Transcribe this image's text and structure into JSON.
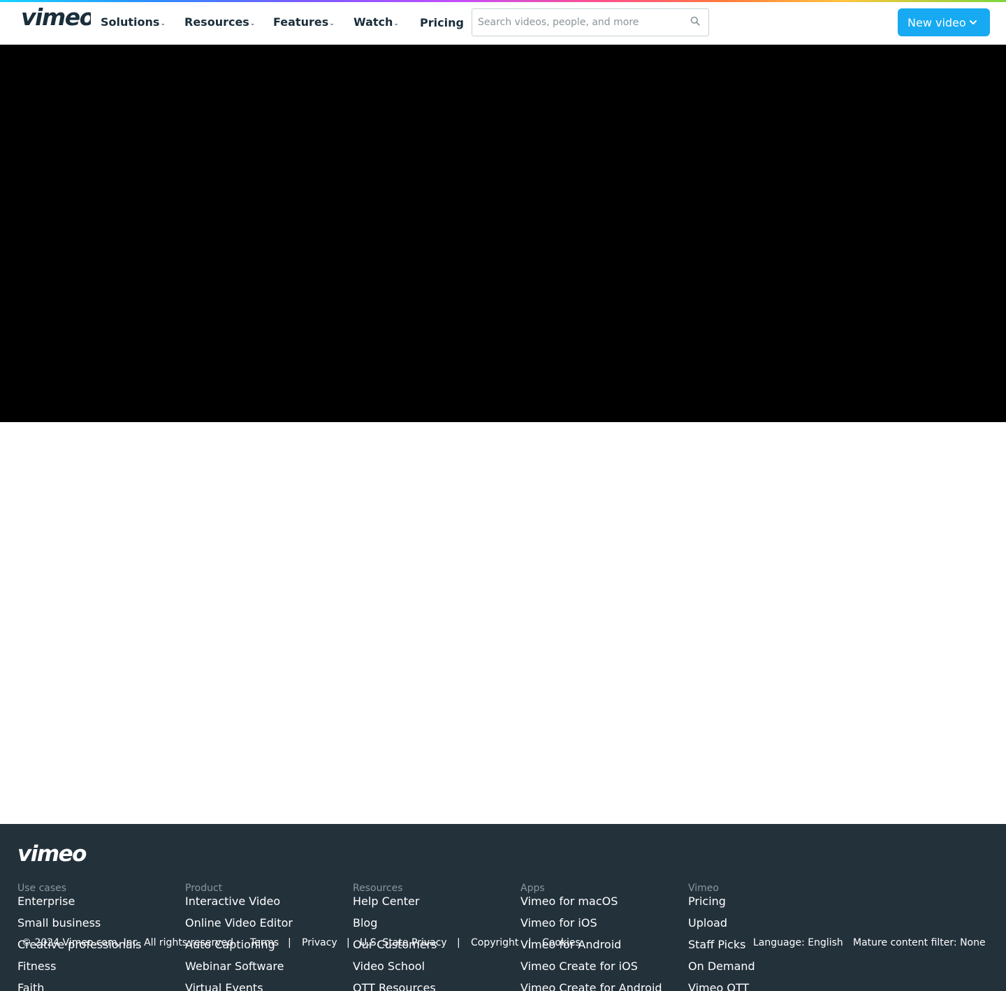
{
  "header": {
    "logo_text": "vimeo",
    "nav": [
      {
        "label": "Solutions",
        "has_dropdown": true
      },
      {
        "label": "Resources",
        "has_dropdown": true
      },
      {
        "label": "Features",
        "has_dropdown": true
      },
      {
        "label": "Watch",
        "has_dropdown": true
      },
      {
        "label": "Pricing",
        "has_dropdown": false
      }
    ],
    "search": {
      "placeholder": "Search videos, people, and more",
      "value": "",
      "icon": "search-icon"
    },
    "new_video_label": "New video",
    "accent_color": "#17aaf2"
  },
  "player": {
    "background": "#000000"
  },
  "footer": {
    "logo_text": "vimeo",
    "background": "#23313b",
    "columns": [
      {
        "heading": "Use cases",
        "links": [
          "Enterprise",
          "Small business",
          "Creative professionals",
          "Fitness",
          "Faith"
        ]
      },
      {
        "heading": "Product",
        "links": [
          "Interactive Video",
          "Online Video Editor",
          "Auto Captioning",
          "Webinar Software",
          "Virtual Events"
        ]
      },
      {
        "heading": "Resources",
        "links": [
          "Help Center",
          "Blog",
          "Our Customers",
          "Video School",
          "OTT Resources"
        ]
      },
      {
        "heading": "Apps",
        "links": [
          "Vimeo for macOS",
          "Vimeo for iOS",
          "Vimeo for Android",
          "Vimeo Create for iOS",
          "Vimeo Create for Android"
        ]
      },
      {
        "heading": "Vimeo",
        "links": [
          "Pricing",
          "Upload",
          "Staff Picks",
          "On Demand",
          "Vimeo OTT"
        ]
      }
    ],
    "legal": {
      "copyright": "© 2024 Vimeo.com, Inc. All rights reserved.",
      "terms": "Terms",
      "privacy": "Privacy",
      "us_state_privacy": "U.S. State Privacy",
      "copyright_link": "Copyright",
      "cookies": "Cookies",
      "separator": "|",
      "language": "Language: English",
      "mature_filter": "Mature content filter: None"
    }
  }
}
